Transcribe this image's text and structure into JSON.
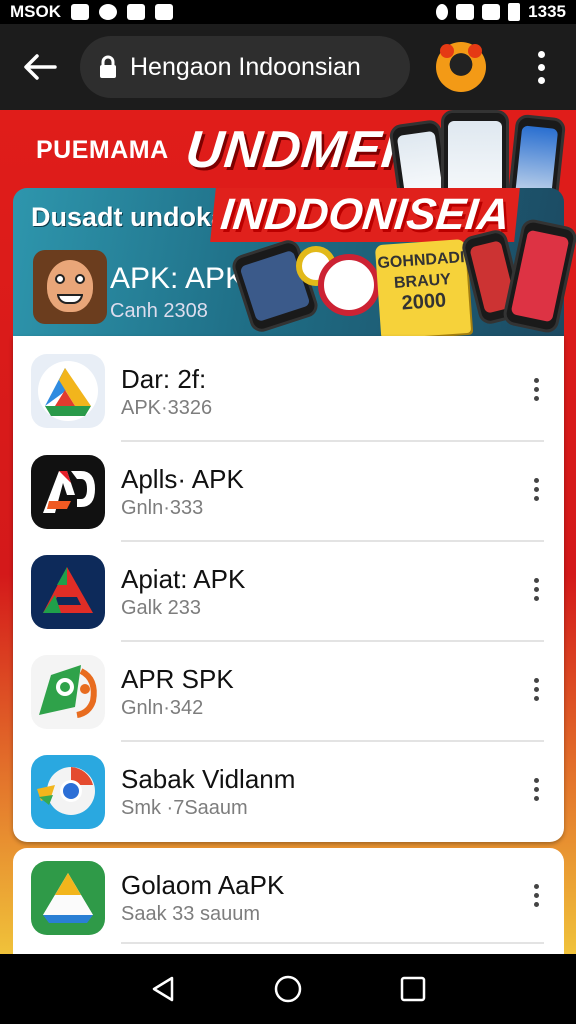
{
  "status_bar": {
    "left_text": "MSOK",
    "time": "1335"
  },
  "browser": {
    "url_text": "Hengaon Indoonsian"
  },
  "banner": {
    "headline_small": "PUEMAMA",
    "headline_big": "UNDMEIH",
    "hero_left_text": "Dusadt undokan",
    "hero_big_text": "INDDONISEIA",
    "hero_title": "APK: APK",
    "hero_subtitle": "Canh 2308",
    "badge_lines": [
      "GOHNDADI",
      "BRAUY",
      "2000"
    ]
  },
  "apps": [
    {
      "title": "Dar: 2f:",
      "subtitle": "APK·3326",
      "icon": "google-ads-triangle-icon"
    },
    {
      "title": "Aplls· APK",
      "subtitle": "Gnln·333",
      "icon": "ap-logo-icon"
    },
    {
      "title": "Apiat: APK",
      "subtitle": "Galk 233",
      "icon": "red-triangle-logo-icon"
    },
    {
      "title": "APR SPK",
      "subtitle": "Gnln·342",
      "icon": "green-puzzle-logo-icon"
    },
    {
      "title": "Sabak Vidlanm",
      "subtitle": "Smk ·7Saaum",
      "icon": "chrome-style-logo-icon"
    },
    {
      "title": "Golaom AaPK",
      "subtitle": "Saak 33 sauum",
      "icon": "drive-style-logo-icon"
    }
  ],
  "colors": {
    "accent_red": "#e01d1a",
    "teal": "#2e96ad",
    "yellow": "#f6d23a"
  }
}
